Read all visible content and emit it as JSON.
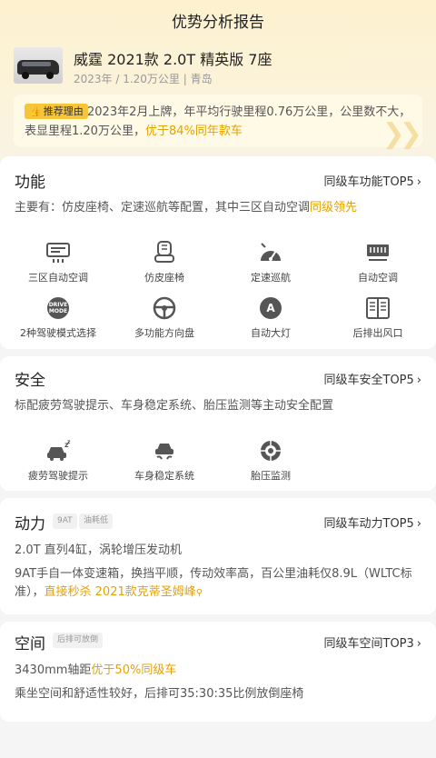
{
  "header": {
    "title": "优势分析报告"
  },
  "car": {
    "name": "威霆 2021款 2.0T 精英版 7座",
    "meta": "2023年 / 1.20万公里 | 青岛"
  },
  "reason": {
    "badge": "推荐理由",
    "text": "2023年2月上牌，年平均行驶里程0.76万公里，公里数不大，表显里程1.20万公里，",
    "highlight": "优于84%同年款车"
  },
  "function": {
    "title": "功能",
    "link": "同级车功能TOP5",
    "desc": "主要有：仿皮座椅、定速巡航等配置，其中三区自动空调",
    "desc_highlight": "同级领先",
    "items": [
      {
        "label": "三区自动空调",
        "icon": "climate-control-icon"
      },
      {
        "label": "仿皮座椅",
        "icon": "seat-icon"
      },
      {
        "label": "定速巡航",
        "icon": "cruise-control-icon"
      },
      {
        "label": "自动空调",
        "icon": "air-conditioner-icon"
      },
      {
        "label": "2种驾驶模式选择",
        "icon": "drive-mode-icon"
      },
      {
        "label": "多功能方向盘",
        "icon": "steering-wheel-icon"
      },
      {
        "label": "自动大灯",
        "icon": "headlight-icon"
      },
      {
        "label": "后排出风口",
        "icon": "rear-vent-icon"
      }
    ],
    "drive_mode_text": "DRIVE\nMODE",
    "headlight_letter": "A"
  },
  "safety": {
    "title": "安全",
    "link": "同级车安全TOP5",
    "desc": "标配疲劳驾驶提示、车身稳定系统、胎压监测等主动安全配置",
    "items": [
      {
        "label": "疲劳驾驶提示",
        "icon": "fatigue-alert-icon"
      },
      {
        "label": "车身稳定系统",
        "icon": "stability-control-icon"
      },
      {
        "label": "胎压监测",
        "icon": "tire-pressure-icon"
      }
    ]
  },
  "power": {
    "title": "动力",
    "tags": [
      "9AT",
      "油耗低"
    ],
    "link": "同级车动力TOP5",
    "line1": "2.0T 直列4缸，涡轮增压发动机",
    "line2": "9AT手自一体变速箱，换挡平顺，传动效率高，百公里油耗仅8.9L（WLTC标准），",
    "line2_highlight": "直接秒杀 2021款克蒂圣姆峰"
  },
  "space": {
    "title": "空间",
    "tags": [
      "后排可放倒"
    ],
    "link": "同级车空间TOP3",
    "line1": "3430mm轴距",
    "line1_highlight": "优于50%同级车",
    "line2": "乘坐空间和舒适性较好，后排可35:30:35比例放倒座椅"
  },
  "colors": {
    "accent": "#e6a200",
    "badge": "#f7c53a",
    "icon": "#555555"
  }
}
